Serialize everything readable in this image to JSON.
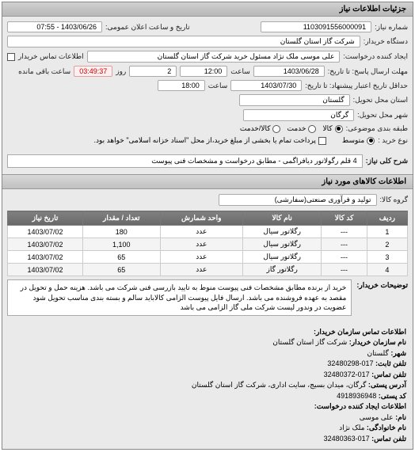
{
  "panel_title": "جزئیات اطلاعات نیاز",
  "fields": {
    "req_no_label": "شماره نیاز:",
    "req_no": "1103091556000091",
    "announce_label": "تاریخ و ساعت اعلان عمومی:",
    "announce": "1403/06/26 - 07:55",
    "buyer_org_label": "دستگاه خریدار:",
    "buyer_org": "شرکت گاز استان گلستان",
    "creator_label": "ایجاد کننده درخواست:",
    "creator": "علی موسی ملک نژاد مسئول خرید شرکت گاز استان گلستان",
    "buyer_contact_label": "اطلاعات تماس خریدار",
    "deadline_label": "مهلت ارسال پاسخ: تا تاریخ:",
    "deadline_date": "1403/06/28",
    "time_label": "ساعت",
    "deadline_time": "12:00",
    "day_label": "روز",
    "days_left": "2",
    "remain_label": "ساعت باقی مانده",
    "remain_time": "03:49:37",
    "validity_label": "حداقل تاریخ اعتبار پیشنهاد: تا تاریخ:",
    "validity_date": "1403/07/30",
    "validity_time": "18:00",
    "province_label": "استان محل تحویل:",
    "province": "گلستان",
    "city_label": "شهر محل تحویل:",
    "city": "گرگان",
    "status_label": "طبقه بندی موضوعی:",
    "status_goods": "کالا",
    "status_service": "خدمت",
    "status_both": "کالا/خدمت",
    "buy_type_label": "نوع خرید :",
    "buy_type_mid": "متوسط",
    "prepay_label": "پرداخت تمام یا بخشی از مبلغ خرید،از محل \"اسناد خزانه اسلامی\" خواهد بود.",
    "main_desc_label": "شرح کلی نیاز:",
    "main_desc": "4 قلم رگولاتور دیافراگمی - مطابق درخواست و مشخصات فنی پیوست",
    "goods_section": "اطلاعات کالاهای مورد نیاز",
    "group_label": "گروه کالا:",
    "group": "تولید و فرآوری صنعتی(سفارشی)"
  },
  "table": {
    "headers": [
      "ردیف",
      "کد کالا",
      "نام کالا",
      "واحد شمارش",
      "تعداد / مقدار",
      "تاریخ نیاز"
    ],
    "rows": [
      [
        "1",
        "---",
        "رگلاتور سیال",
        "عدد",
        "180",
        "1403/07/02"
      ],
      [
        "2",
        "---",
        "رگلاتور سیال",
        "عدد",
        "1,100",
        "1403/07/02"
      ],
      [
        "3",
        "---",
        "رگلاتور سیال",
        "عدد",
        "65",
        "1403/07/02"
      ],
      [
        "4",
        "---",
        "رگلاتور گاز",
        "عدد",
        "65",
        "1403/07/02"
      ]
    ]
  },
  "notes": {
    "label": "توضیحات خریدار:",
    "text": "خرید از برنده مطابق مشخصات فنی پیوست منوط به تایید بازرسی فنی شرکت می باشد. هزینه حمل و تحویل در مقصد به عهده فروشنده می باشد. ارسال فایل پیوست الزامی کالاباید سالم و بسته بندی مناسب تحویل شود عضویت در وندور لیست شرکت ملی گاز الزامی می باشد"
  },
  "contact": {
    "header": "اطلاعات تماس سازمان خریدار:",
    "org_label": "نام سازمان خریدار:",
    "org": "شرکت گاز استان گلستان",
    "city_label": "شهر:",
    "city": "گلستان",
    "phone_label": "تلفن ثابت:",
    "phone": "017-32480298",
    "fax_label": "تلفن تماس:",
    "fax": "017-32480372",
    "addr_label": "آدرس پستی:",
    "addr": "گرگان، میدان بسیج، سایت اداری، شرکت گاز استان گلستان",
    "zip_label": "کد پستی:",
    "zip": "4918936948",
    "sub_header": "اطلاعات ایجاد کننده درخواست:",
    "name_label": "نام:",
    "name": "علی موسی",
    "lname_label": "نام خانوادگی:",
    "lname": "ملک نژاد",
    "cphone_label": "تلفن تماس:",
    "cphone": "017-32480363"
  }
}
